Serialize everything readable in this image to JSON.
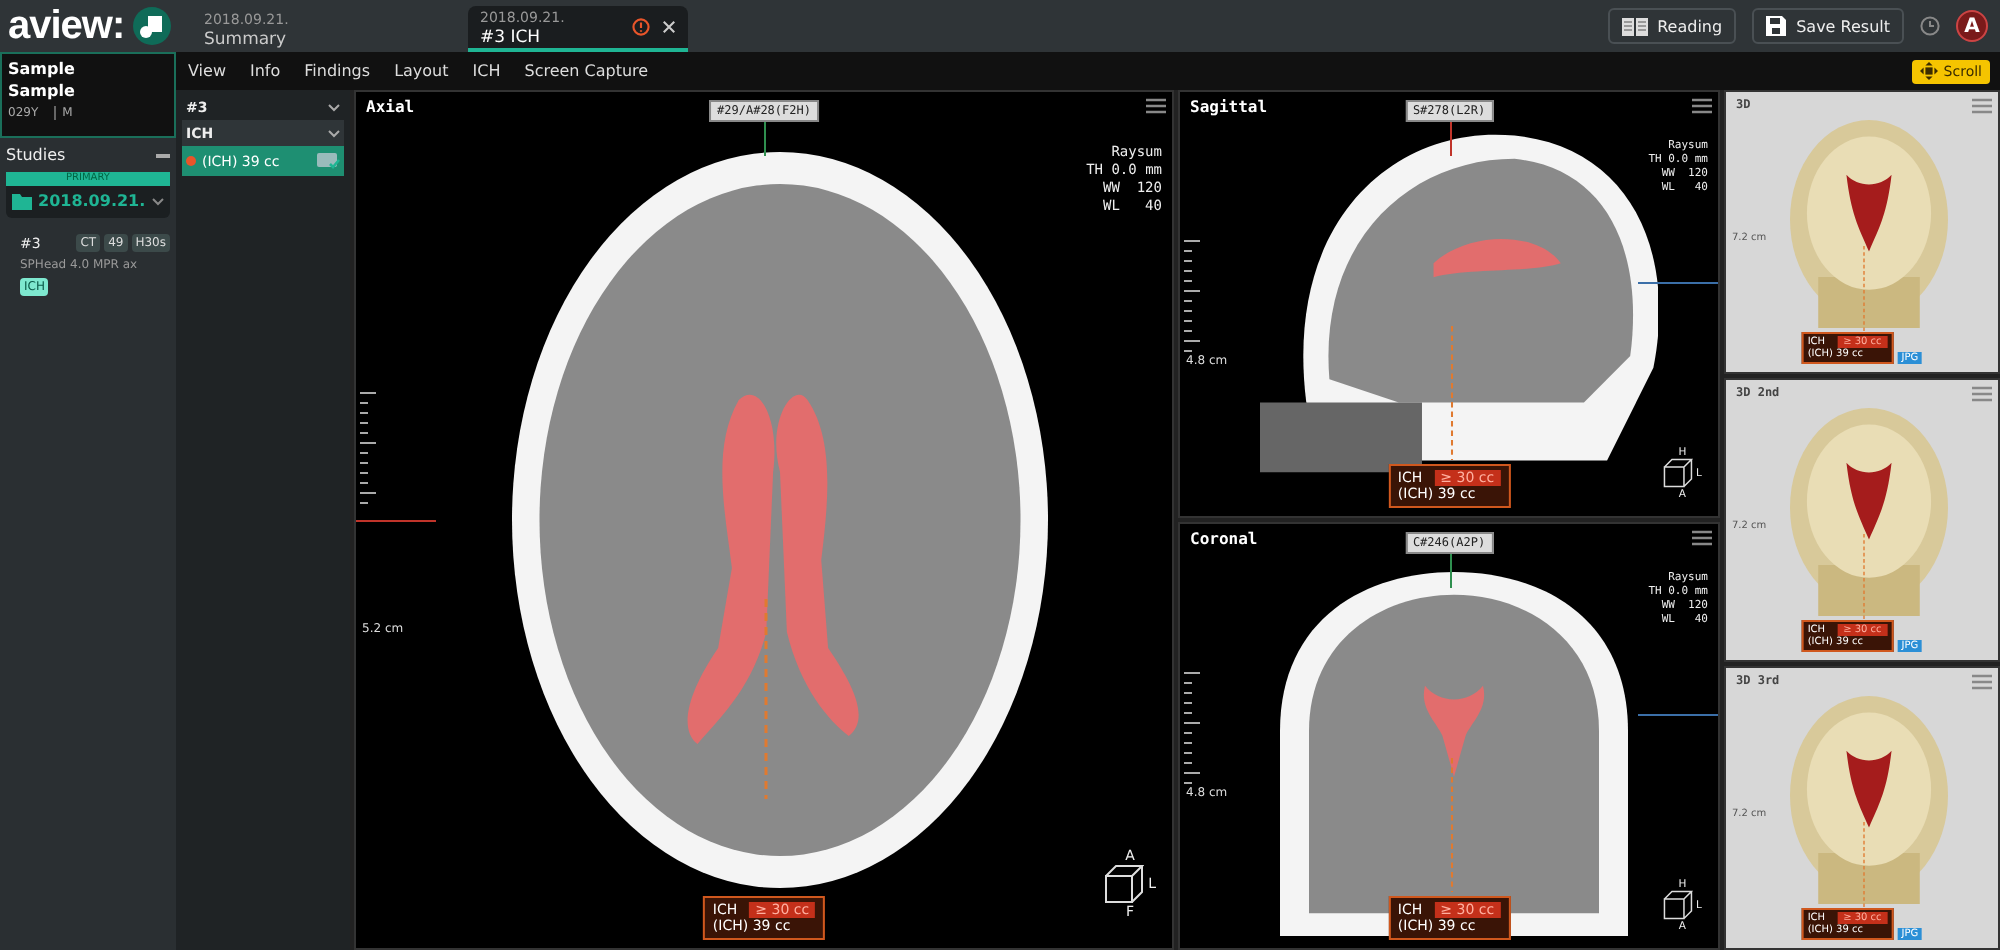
{
  "logo": "aview:",
  "tabs": [
    {
      "date": "2018.09.21.",
      "label": "Summary",
      "selected": false,
      "closable": false
    },
    {
      "date": "2018.09.21.",
      "label": "#3 ICH",
      "selected": true,
      "closable": true
    }
  ],
  "header_buttons": [
    {
      "kind": "book",
      "label": "Reading"
    },
    {
      "kind": "save",
      "label": "Save Result"
    }
  ],
  "avatar": "A",
  "patient": {
    "name": "Sample",
    "name2": "Sample",
    "age": "029Y",
    "sex": "M"
  },
  "menu": [
    "View",
    "Info",
    "Findings",
    "Layout",
    "ICH",
    "Screen Capture"
  ],
  "scroll_button": "Scroll",
  "studies": {
    "title": "Studies",
    "badge": "PRIMARY",
    "date": "2018.09.21.",
    "series": {
      "number": "#3",
      "tags": [
        "CT",
        "49",
        "H30s"
      ],
      "description": "SPHead 4.0 MPR ax",
      "chip": "ICH"
    }
  },
  "series_panel": {
    "series": "#3",
    "analysis": "ICH",
    "findings": [
      {
        "label": "(ICH) 39 cc",
        "color": "#e8552a",
        "selected": true
      }
    ]
  },
  "viewport_columns": [
    [
      {
        "kind": "axial",
        "title": "Axial",
        "slice": "#29/A#28(F2H)",
        "info": [
          "Raysum",
          "TH 0.0 mm",
          "WW  120",
          "WL   40"
        ],
        "scale": "5.2 cm",
        "callout": {
          "name": "ICH",
          "threshold": "≥ 30 cc",
          "volume": "(ICH) 39 cc"
        },
        "orientation": [
          "A",
          "F",
          "L"
        ]
      }
    ],
    [
      {
        "kind": "sagittal",
        "title": "Sagittal",
        "slice": "S#278(L2R)",
        "info": [
          "Raysum",
          "TH 0.0 mm",
          "WW  120",
          "WL   40"
        ],
        "scale": "4.8 cm",
        "callout": {
          "name": "ICH",
          "threshold": "≥ 30 cc",
          "volume": "(ICH) 39 cc"
        },
        "orientation": [
          "H",
          "A",
          "L"
        ]
      },
      {
        "kind": "coronal",
        "title": "Coronal",
        "slice": "C#246(A2P)",
        "info": [
          "Raysum",
          "TH 0.0 mm",
          "WW  120",
          "WL   40"
        ],
        "scale": "4.8 cm",
        "callout": {
          "name": "ICH",
          "threshold": "≥ 30 cc",
          "volume": "(ICH) 39 cc"
        },
        "orientation": [
          "H",
          "A",
          "L"
        ]
      }
    ],
    [
      {
        "kind": "render3d",
        "title": "3D",
        "scale": "7.2 cm",
        "callout": {
          "name": "ICH",
          "threshold": "≥ 30 cc",
          "volume": "(ICH) 39 cc",
          "chip": "JPG"
        }
      },
      {
        "kind": "render3d",
        "title": "3D 2nd",
        "scale": "7.2 cm",
        "callout": {
          "name": "ICH",
          "threshold": "≥ 30 cc",
          "volume": "(ICH) 39 cc",
          "chip": "JPG"
        }
      },
      {
        "kind": "render3d",
        "title": "3D 3rd",
        "scale": "7.2 cm",
        "callout": {
          "name": "ICH",
          "threshold": "≥ 30 cc",
          "volume": "(ICH) 39 cc",
          "chip": "JPG"
        }
      }
    ]
  ]
}
